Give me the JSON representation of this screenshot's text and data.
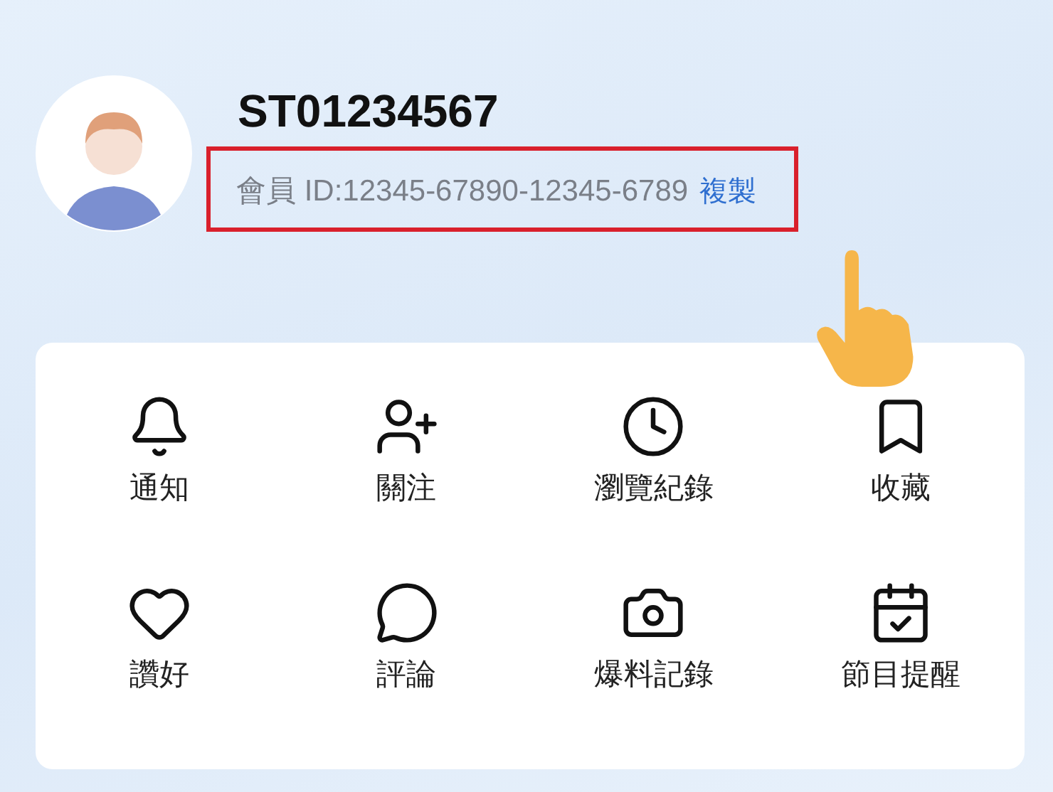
{
  "profile": {
    "username": "ST01234567",
    "member_id": "會員 ID:12345-67890-12345-6789",
    "copy_link": "複製"
  },
  "menu": [
    {
      "kind": "bell",
      "label": "通知"
    },
    {
      "kind": "user-plus",
      "label": "關注"
    },
    {
      "kind": "clock",
      "label": "瀏覽紀錄"
    },
    {
      "kind": "bookmark",
      "label": "收藏"
    },
    {
      "kind": "heart",
      "label": "讚好"
    },
    {
      "kind": "chat",
      "label": "評論"
    },
    {
      "kind": "camera",
      "label": "爆料記錄"
    },
    {
      "kind": "calendar",
      "label": "節目提醒"
    }
  ]
}
